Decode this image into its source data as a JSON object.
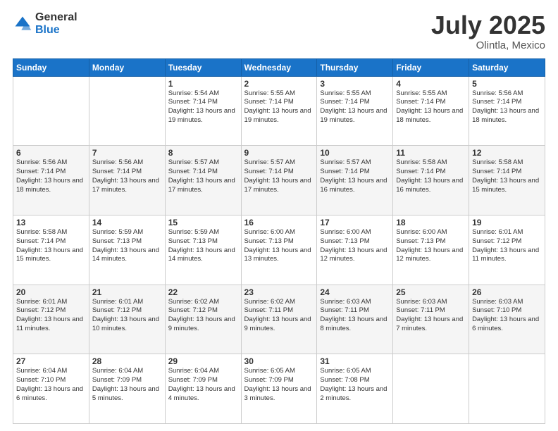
{
  "header": {
    "logo_general": "General",
    "logo_blue": "Blue",
    "title": "July 2025",
    "location": "Olintla, Mexico"
  },
  "days_of_week": [
    "Sunday",
    "Monday",
    "Tuesday",
    "Wednesday",
    "Thursday",
    "Friday",
    "Saturday"
  ],
  "weeks": [
    [
      {
        "day": "",
        "info": ""
      },
      {
        "day": "",
        "info": ""
      },
      {
        "day": "1",
        "info": "Sunrise: 5:54 AM\nSunset: 7:14 PM\nDaylight: 13 hours and 19 minutes."
      },
      {
        "day": "2",
        "info": "Sunrise: 5:55 AM\nSunset: 7:14 PM\nDaylight: 13 hours and 19 minutes."
      },
      {
        "day": "3",
        "info": "Sunrise: 5:55 AM\nSunset: 7:14 PM\nDaylight: 13 hours and 19 minutes."
      },
      {
        "day": "4",
        "info": "Sunrise: 5:55 AM\nSunset: 7:14 PM\nDaylight: 13 hours and 18 minutes."
      },
      {
        "day": "5",
        "info": "Sunrise: 5:56 AM\nSunset: 7:14 PM\nDaylight: 13 hours and 18 minutes."
      }
    ],
    [
      {
        "day": "6",
        "info": "Sunrise: 5:56 AM\nSunset: 7:14 PM\nDaylight: 13 hours and 18 minutes."
      },
      {
        "day": "7",
        "info": "Sunrise: 5:56 AM\nSunset: 7:14 PM\nDaylight: 13 hours and 17 minutes."
      },
      {
        "day": "8",
        "info": "Sunrise: 5:57 AM\nSunset: 7:14 PM\nDaylight: 13 hours and 17 minutes."
      },
      {
        "day": "9",
        "info": "Sunrise: 5:57 AM\nSunset: 7:14 PM\nDaylight: 13 hours and 17 minutes."
      },
      {
        "day": "10",
        "info": "Sunrise: 5:57 AM\nSunset: 7:14 PM\nDaylight: 13 hours and 16 minutes."
      },
      {
        "day": "11",
        "info": "Sunrise: 5:58 AM\nSunset: 7:14 PM\nDaylight: 13 hours and 16 minutes."
      },
      {
        "day": "12",
        "info": "Sunrise: 5:58 AM\nSunset: 7:14 PM\nDaylight: 13 hours and 15 minutes."
      }
    ],
    [
      {
        "day": "13",
        "info": "Sunrise: 5:58 AM\nSunset: 7:14 PM\nDaylight: 13 hours and 15 minutes."
      },
      {
        "day": "14",
        "info": "Sunrise: 5:59 AM\nSunset: 7:13 PM\nDaylight: 13 hours and 14 minutes."
      },
      {
        "day": "15",
        "info": "Sunrise: 5:59 AM\nSunset: 7:13 PM\nDaylight: 13 hours and 14 minutes."
      },
      {
        "day": "16",
        "info": "Sunrise: 6:00 AM\nSunset: 7:13 PM\nDaylight: 13 hours and 13 minutes."
      },
      {
        "day": "17",
        "info": "Sunrise: 6:00 AM\nSunset: 7:13 PM\nDaylight: 13 hours and 12 minutes."
      },
      {
        "day": "18",
        "info": "Sunrise: 6:00 AM\nSunset: 7:13 PM\nDaylight: 13 hours and 12 minutes."
      },
      {
        "day": "19",
        "info": "Sunrise: 6:01 AM\nSunset: 7:12 PM\nDaylight: 13 hours and 11 minutes."
      }
    ],
    [
      {
        "day": "20",
        "info": "Sunrise: 6:01 AM\nSunset: 7:12 PM\nDaylight: 13 hours and 11 minutes."
      },
      {
        "day": "21",
        "info": "Sunrise: 6:01 AM\nSunset: 7:12 PM\nDaylight: 13 hours and 10 minutes."
      },
      {
        "day": "22",
        "info": "Sunrise: 6:02 AM\nSunset: 7:12 PM\nDaylight: 13 hours and 9 minutes."
      },
      {
        "day": "23",
        "info": "Sunrise: 6:02 AM\nSunset: 7:11 PM\nDaylight: 13 hours and 9 minutes."
      },
      {
        "day": "24",
        "info": "Sunrise: 6:03 AM\nSunset: 7:11 PM\nDaylight: 13 hours and 8 minutes."
      },
      {
        "day": "25",
        "info": "Sunrise: 6:03 AM\nSunset: 7:11 PM\nDaylight: 13 hours and 7 minutes."
      },
      {
        "day": "26",
        "info": "Sunrise: 6:03 AM\nSunset: 7:10 PM\nDaylight: 13 hours and 6 minutes."
      }
    ],
    [
      {
        "day": "27",
        "info": "Sunrise: 6:04 AM\nSunset: 7:10 PM\nDaylight: 13 hours and 6 minutes."
      },
      {
        "day": "28",
        "info": "Sunrise: 6:04 AM\nSunset: 7:09 PM\nDaylight: 13 hours and 5 minutes."
      },
      {
        "day": "29",
        "info": "Sunrise: 6:04 AM\nSunset: 7:09 PM\nDaylight: 13 hours and 4 minutes."
      },
      {
        "day": "30",
        "info": "Sunrise: 6:05 AM\nSunset: 7:09 PM\nDaylight: 13 hours and 3 minutes."
      },
      {
        "day": "31",
        "info": "Sunrise: 6:05 AM\nSunset: 7:08 PM\nDaylight: 13 hours and 2 minutes."
      },
      {
        "day": "",
        "info": ""
      },
      {
        "day": "",
        "info": ""
      }
    ]
  ]
}
